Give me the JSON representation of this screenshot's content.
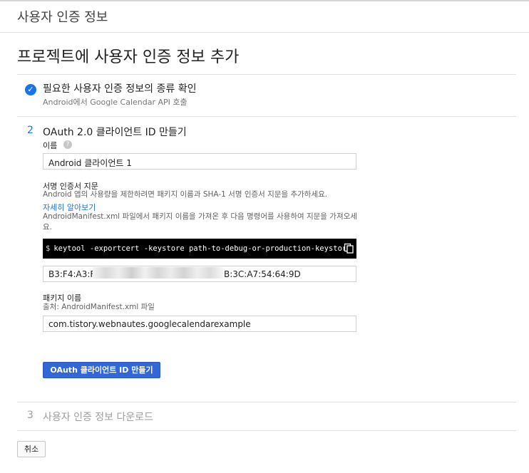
{
  "page_title": "사용자 인증 정보",
  "heading": "프로젝트에 사용자 인증 정보 추가",
  "colors": {
    "accent": "#1a73e8",
    "primary_button": "#3367d6",
    "disabled_text": "#9e9e9e"
  },
  "step1": {
    "icon": "check-circle-icon",
    "title": "필요한 사용자 인증 정보의 종류 확인",
    "subtitle": "Android에서 Google Calendar API 호출"
  },
  "step2": {
    "number": "2",
    "title": "OAuth 2.0 클라이언트 ID 만들기",
    "name_label": "이름",
    "name_value": "Android 클라이언트 1",
    "fingerprint_label": "서명 인증서 지문",
    "fingerprint_desc": "Android 앱의 사용량을 제한하려면 패키지 이름과 SHA-1 서명 인증서 지문을 추가하세요.",
    "learn_more": "자세히 알아보기",
    "manifest_desc": "AndroidManifest.xml 파일에서 패키지 이름을 가져온 후 다음 명령어를 사용하여 지문을 가져오세요.",
    "command_prompt": "$",
    "command": "keytool -exportcert -keystore path-to-debug-or-production-keystore -list -v",
    "sha1_prefix": "B3:F4:A3:F",
    "sha1_suffix": "B:3C:A7:54:64:9D",
    "package_label": "패키지 이름",
    "package_source": "출처: AndroidManifest.xml 파일",
    "package_value": "com.tistory.webnautes.googlecalendarexample",
    "create_button": "OAuth 클라이언트 ID 만들기"
  },
  "step3": {
    "number": "3",
    "title": "사용자 인증 정보 다운로드"
  },
  "cancel_button": "취소"
}
